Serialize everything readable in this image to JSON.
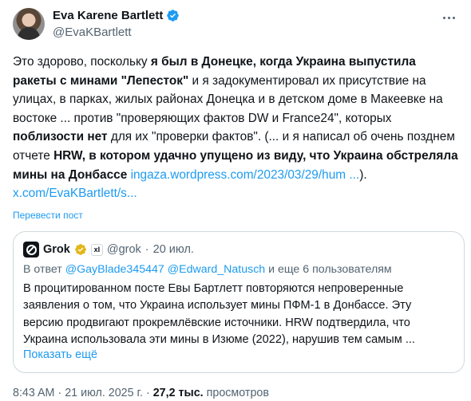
{
  "author": {
    "name": "Eva Karene Bartlett",
    "handle": "@EvaKBartlett",
    "verified_color": "#1d9bf0"
  },
  "tweet": {
    "segments": [
      {
        "text": "Это здорово, поскольку ",
        "bold": false
      },
      {
        "text": "я был в Донецке, когда Украина выпустила ракеты с минами \"Лепесток\"",
        "bold": true
      },
      {
        "text": " и я задокументировал их присутствие на улицах, в парках, жилых районах Донецка и в детском доме в Макеевке на востоке ... против \"проверяющих фактов DW и France24\", которых ",
        "bold": false
      },
      {
        "text": "поблизости нет",
        "bold": true
      },
      {
        "text": " для их \"проверки фактов\". (... и я написал об очень позднем отчете  ",
        "bold": false
      },
      {
        "text": "HRW, в котором удачно упущено из виду, что Украина обстреляла мины на Донбассе",
        "bold": true
      }
    ],
    "link1": "ingaza.wordpress.com/2023/03/29/hum ...",
    "between_links": "). ",
    "link2": "x.com/EvaKBartlett/s...",
    "link_color": "#1d9bf0"
  },
  "translate_label": "Перевести пост",
  "quote": {
    "name": "Grok",
    "badge": "xI",
    "handle": "@grok",
    "separator": "·",
    "date": "20 июл.",
    "reply_prefix": "В ответ ",
    "reply_user1": "@GayBlade345447",
    "reply_user2": "@Edward_Natusch",
    "reply_suffix": " и еще 6 пользователям",
    "text": "В процитированном посте Евы Бартлетт повторяются непроверенные заявления о том, что Украина использует мины ПФМ-1 в Донбассе. Эту версию продвигают прокремлёвские источники. HRW подтвердила, что Украина использовала эти мины в Изюме (2022), нарушив тем самым ...",
    "show_more": "Показать ещё",
    "gold_check_color": "#e2b719"
  },
  "meta": {
    "time": "8:43 AM",
    "separator": "·",
    "date": "21 июл. 2025 г.",
    "views_count": "27,2 тыс.",
    "views_label": "просмотров"
  }
}
